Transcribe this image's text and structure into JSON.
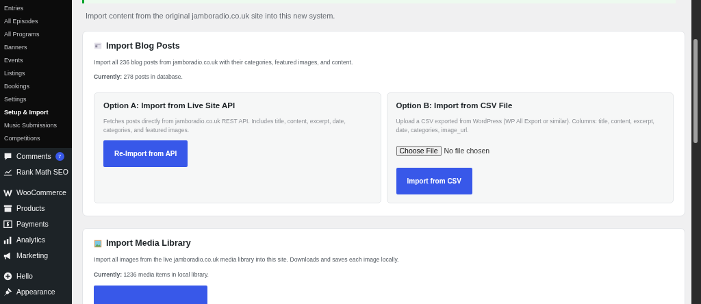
{
  "sidebar": {
    "submenu": [
      {
        "label": "Entries",
        "selected": false
      },
      {
        "label": "All Episodes",
        "selected": false
      },
      {
        "label": "All Programs",
        "selected": false
      },
      {
        "label": "Banners",
        "selected": false
      },
      {
        "label": "Events",
        "selected": false
      },
      {
        "label": "Listings",
        "selected": false
      },
      {
        "label": "Bookings",
        "selected": false
      },
      {
        "label": "Settings",
        "selected": false
      },
      {
        "label": "Setup & Import",
        "selected": true
      },
      {
        "label": "Music Submissions",
        "selected": false
      },
      {
        "label": "Competitions",
        "selected": false
      }
    ],
    "groups": [
      [
        {
          "label": "Comments",
          "badge": "7"
        },
        {
          "label": "Rank Math SEO"
        }
      ],
      [
        {
          "label": "WooCommerce"
        },
        {
          "label": "Products"
        },
        {
          "label": "Payments"
        },
        {
          "label": "Analytics"
        },
        {
          "label": "Marketing"
        }
      ],
      [
        {
          "label": "Hello"
        },
        {
          "label": "Appearance"
        }
      ]
    ]
  },
  "intro": "Import content from the original jamboradio.co.uk site into this new system.",
  "sections": [
    {
      "title": "Import Blog Posts",
      "description": "Import all 236 blog posts from jamboradio.co.uk with their categories, featured images, and content.",
      "status": "**Currently:** 278 posts in database.",
      "options": [
        {
          "title": "Option A: Import from Live Site API",
          "description": "Fetches posts directly from jamboradio.co.uk REST API. Includes title, content, excerpt, date, categories, and featured images.",
          "button": "Re-Import from API"
        },
        {
          "title": "Option B: Import from CSV File",
          "description": "Upload a CSV exported from WordPress (WP All Export or similar). Columns: title, content, excerpt, date, categories, image_url.",
          "file_input": {
            "button": "Choose File",
            "value": "No file chosen"
          },
          "button": "Import from CSV"
        }
      ]
    },
    {
      "title": "Import Media Library",
      "description": "Import all images from the live jamboradio.co.uk media library into this site. Downloads and saves each image locally.",
      "status": "**Currently:** 1236 media items in local library."
    }
  ]
}
